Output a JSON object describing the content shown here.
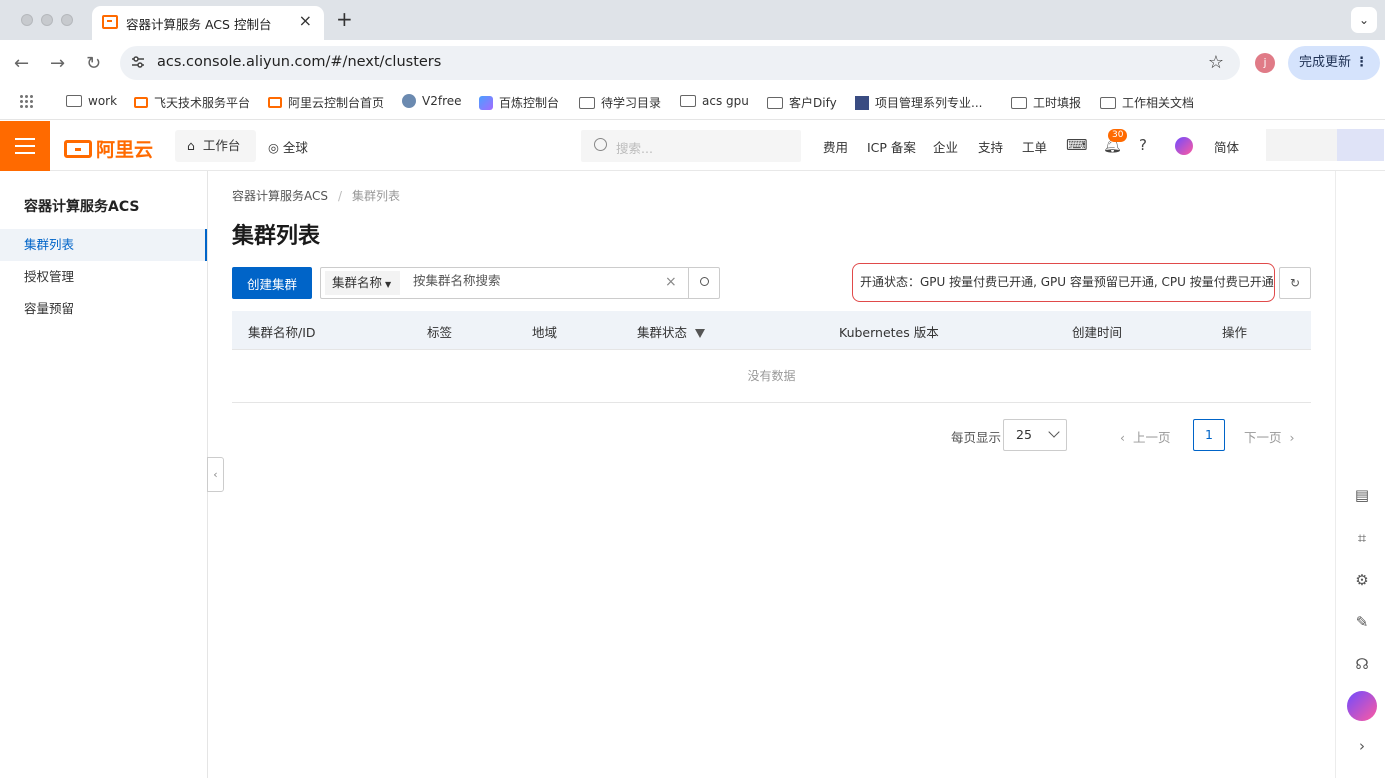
{
  "browser": {
    "tab_title": "容器计算服务 ACS 控制台",
    "url": "acs.console.aliyun.com/#/next/clusters",
    "profile_initial": "j",
    "update_label": "完成更新",
    "bookmarks": [
      "work",
      "飞天技术服务平台",
      "阿里云控制台首页",
      "V2free",
      "百炼控制台",
      "待学习目录",
      "acs gpu",
      "客户Dify",
      "项目管理系列专业...",
      "工时填报",
      "工作相关文档"
    ]
  },
  "topnav": {
    "logo_text": "阿里云",
    "workbench": "工作台",
    "region": "全球",
    "search_placeholder": "搜索...",
    "links": [
      "费用",
      "ICP 备案",
      "企业",
      "支持",
      "工单"
    ],
    "notification_count": "30",
    "language": "简体"
  },
  "sidebar": {
    "title": "容器计算服务ACS",
    "items": [
      "集群列表",
      "授权管理",
      "容量预留"
    ]
  },
  "main": {
    "breadcrumb": [
      "容器计算服务ACS",
      "集群列表"
    ],
    "title": "集群列表",
    "create_button": "创建集群",
    "search_field_select": "集群名称",
    "search_placeholder": "按集群名称搜索",
    "status_text": "开通状态：GPU 按量付费已开通, GPU 容量预留已开通, CPU 按量付费已开通",
    "table_headers": [
      "集群名称/ID",
      "标签",
      "地域",
      "集群状态",
      "Kubernetes 版本",
      "创建时间",
      "操作"
    ],
    "empty_text": "没有数据",
    "pager": {
      "page_size_label": "每页显示",
      "page_size": "25",
      "prev": "上一页",
      "current_page": "1",
      "next": "下一页"
    }
  },
  "colors": {
    "brand_orange": "#ff6a00",
    "primary_blue": "#0064c8",
    "status_border_red": "#e04a4a"
  }
}
